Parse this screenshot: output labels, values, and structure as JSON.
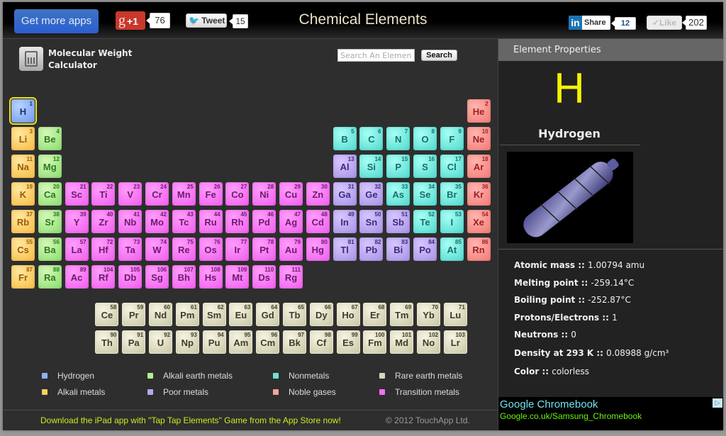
{
  "header": {
    "get_apps_label": "Get more apps",
    "gplus_label": "+1",
    "gplus_count": "76",
    "tweet_label": "Tweet",
    "tweet_count": "15",
    "title": "Chemical Elements",
    "linkedin_label": "Share",
    "linkedin_count": "12",
    "like_label": "✓Like",
    "like_count": "202"
  },
  "toolbar": {
    "calculator_line1": "Molecular Weight",
    "calculator_line2": "Calculator",
    "search_placeholder": "Search An Element",
    "search_button": "Search"
  },
  "selected_element": "H",
  "elements": [
    {
      "s": "H",
      "n": 1,
      "c": "hydrogen",
      "r": 1,
      "col": 1
    },
    {
      "s": "He",
      "n": 2,
      "c": "noble",
      "r": 1,
      "col": 18
    },
    {
      "s": "Li",
      "n": 3,
      "c": "alkali",
      "r": 2,
      "col": 1
    },
    {
      "s": "Be",
      "n": 4,
      "c": "earth",
      "r": 2,
      "col": 2
    },
    {
      "s": "B",
      "n": 5,
      "c": "nonmetal",
      "r": 2,
      "col": 13
    },
    {
      "s": "C",
      "n": 6,
      "c": "nonmetal",
      "r": 2,
      "col": 14
    },
    {
      "s": "N",
      "n": 7,
      "c": "nonmetal",
      "r": 2,
      "col": 15
    },
    {
      "s": "O",
      "n": 8,
      "c": "nonmetal",
      "r": 2,
      "col": 16
    },
    {
      "s": "F",
      "n": 9,
      "c": "nonmetal",
      "r": 2,
      "col": 17
    },
    {
      "s": "Ne",
      "n": 10,
      "c": "noble",
      "r": 2,
      "col": 18
    },
    {
      "s": "Na",
      "n": 11,
      "c": "alkali",
      "r": 3,
      "col": 1
    },
    {
      "s": "Mg",
      "n": 12,
      "c": "earth",
      "r": 3,
      "col": 2
    },
    {
      "s": "Al",
      "n": 13,
      "c": "poor",
      "r": 3,
      "col": 13
    },
    {
      "s": "Si",
      "n": 14,
      "c": "nonmetal",
      "r": 3,
      "col": 14
    },
    {
      "s": "P",
      "n": 15,
      "c": "nonmetal",
      "r": 3,
      "col": 15
    },
    {
      "s": "S",
      "n": 16,
      "c": "nonmetal",
      "r": 3,
      "col": 16
    },
    {
      "s": "Cl",
      "n": 17,
      "c": "nonmetal",
      "r": 3,
      "col": 17
    },
    {
      "s": "Ar",
      "n": 18,
      "c": "noble",
      "r": 3,
      "col": 18
    },
    {
      "s": "K",
      "n": 19,
      "c": "alkali",
      "r": 4,
      "col": 1
    },
    {
      "s": "Ca",
      "n": 20,
      "c": "earth",
      "r": 4,
      "col": 2
    },
    {
      "s": "Sc",
      "n": 21,
      "c": "transition",
      "r": 4,
      "col": 3
    },
    {
      "s": "Ti",
      "n": 22,
      "c": "transition",
      "r": 4,
      "col": 4
    },
    {
      "s": "V",
      "n": 23,
      "c": "transition",
      "r": 4,
      "col": 5
    },
    {
      "s": "Cr",
      "n": 24,
      "c": "transition",
      "r": 4,
      "col": 6
    },
    {
      "s": "Mn",
      "n": 25,
      "c": "transition",
      "r": 4,
      "col": 7
    },
    {
      "s": "Fe",
      "n": 26,
      "c": "transition",
      "r": 4,
      "col": 8
    },
    {
      "s": "Co",
      "n": 27,
      "c": "transition",
      "r": 4,
      "col": 9
    },
    {
      "s": "Ni",
      "n": 28,
      "c": "transition",
      "r": 4,
      "col": 10
    },
    {
      "s": "Cu",
      "n": 29,
      "c": "transition",
      "r": 4,
      "col": 11
    },
    {
      "s": "Zn",
      "n": 30,
      "c": "transition",
      "r": 4,
      "col": 12
    },
    {
      "s": "Ga",
      "n": 31,
      "c": "poor",
      "r": 4,
      "col": 13
    },
    {
      "s": "Ge",
      "n": 32,
      "c": "poor",
      "r": 4,
      "col": 14
    },
    {
      "s": "As",
      "n": 33,
      "c": "nonmetal",
      "r": 4,
      "col": 15
    },
    {
      "s": "Se",
      "n": 34,
      "c": "nonmetal",
      "r": 4,
      "col": 16
    },
    {
      "s": "Br",
      "n": 35,
      "c": "nonmetal",
      "r": 4,
      "col": 17
    },
    {
      "s": "Kr",
      "n": 36,
      "c": "noble",
      "r": 4,
      "col": 18
    },
    {
      "s": "Rb",
      "n": 37,
      "c": "alkali",
      "r": 5,
      "col": 1
    },
    {
      "s": "Sr",
      "n": 38,
      "c": "earth",
      "r": 5,
      "col": 2
    },
    {
      "s": "Y",
      "n": 39,
      "c": "transition",
      "r": 5,
      "col": 3
    },
    {
      "s": "Zr",
      "n": 40,
      "c": "transition",
      "r": 5,
      "col": 4
    },
    {
      "s": "Nb",
      "n": 41,
      "c": "transition",
      "r": 5,
      "col": 5
    },
    {
      "s": "Mo",
      "n": 42,
      "c": "transition",
      "r": 5,
      "col": 6
    },
    {
      "s": "Tc",
      "n": 43,
      "c": "transition",
      "r": 5,
      "col": 7
    },
    {
      "s": "Ru",
      "n": 44,
      "c": "transition",
      "r": 5,
      "col": 8
    },
    {
      "s": "Rh",
      "n": 45,
      "c": "transition",
      "r": 5,
      "col": 9
    },
    {
      "s": "Pd",
      "n": 46,
      "c": "transition",
      "r": 5,
      "col": 10
    },
    {
      "s": "Ag",
      "n": 47,
      "c": "transition",
      "r": 5,
      "col": 11
    },
    {
      "s": "Cd",
      "n": 48,
      "c": "transition",
      "r": 5,
      "col": 12
    },
    {
      "s": "In",
      "n": 49,
      "c": "poor",
      "r": 5,
      "col": 13
    },
    {
      "s": "Sn",
      "n": 50,
      "c": "poor",
      "r": 5,
      "col": 14
    },
    {
      "s": "Sb",
      "n": 51,
      "c": "poor",
      "r": 5,
      "col": 15
    },
    {
      "s": "Te",
      "n": 52,
      "c": "nonmetal",
      "r": 5,
      "col": 16
    },
    {
      "s": "I",
      "n": 53,
      "c": "nonmetal",
      "r": 5,
      "col": 17
    },
    {
      "s": "Xe",
      "n": 54,
      "c": "noble",
      "r": 5,
      "col": 18
    },
    {
      "s": "Cs",
      "n": 55,
      "c": "alkali",
      "r": 6,
      "col": 1
    },
    {
      "s": "Ba",
      "n": 56,
      "c": "earth",
      "r": 6,
      "col": 2
    },
    {
      "s": "La",
      "n": 57,
      "c": "transition",
      "r": 6,
      "col": 3
    },
    {
      "s": "Hf",
      "n": 72,
      "c": "transition",
      "r": 6,
      "col": 4
    },
    {
      "s": "Ta",
      "n": 73,
      "c": "transition",
      "r": 6,
      "col": 5
    },
    {
      "s": "W",
      "n": 74,
      "c": "transition",
      "r": 6,
      "col": 6
    },
    {
      "s": "Re",
      "n": 75,
      "c": "transition",
      "r": 6,
      "col": 7
    },
    {
      "s": "Os",
      "n": 76,
      "c": "transition",
      "r": 6,
      "col": 8
    },
    {
      "s": "Ir",
      "n": 77,
      "c": "transition",
      "r": 6,
      "col": 9
    },
    {
      "s": "Pt",
      "n": 78,
      "c": "transition",
      "r": 6,
      "col": 10
    },
    {
      "s": "Au",
      "n": 79,
      "c": "transition",
      "r": 6,
      "col": 11
    },
    {
      "s": "Hg",
      "n": 80,
      "c": "transition",
      "r": 6,
      "col": 12
    },
    {
      "s": "Tl",
      "n": 81,
      "c": "poor",
      "r": 6,
      "col": 13
    },
    {
      "s": "Pb",
      "n": 82,
      "c": "poor",
      "r": 6,
      "col": 14
    },
    {
      "s": "Bi",
      "n": 83,
      "c": "poor",
      "r": 6,
      "col": 15
    },
    {
      "s": "Po",
      "n": 84,
      "c": "poor",
      "r": 6,
      "col": 16
    },
    {
      "s": "At",
      "n": 85,
      "c": "nonmetal",
      "r": 6,
      "col": 17
    },
    {
      "s": "Rn",
      "n": 86,
      "c": "noble",
      "r": 6,
      "col": 18
    },
    {
      "s": "Fr",
      "n": 87,
      "c": "alkali",
      "r": 7,
      "col": 1
    },
    {
      "s": "Ra",
      "n": 88,
      "c": "earth",
      "r": 7,
      "col": 2
    },
    {
      "s": "Ac",
      "n": 89,
      "c": "transition",
      "r": 7,
      "col": 3
    },
    {
      "s": "Rf",
      "n": 104,
      "c": "transition",
      "r": 7,
      "col": 4
    },
    {
      "s": "Db",
      "n": 105,
      "c": "transition",
      "r": 7,
      "col": 5
    },
    {
      "s": "Sg",
      "n": 106,
      "c": "transition",
      "r": 7,
      "col": 6
    },
    {
      "s": "Bh",
      "n": 107,
      "c": "transition",
      "r": 7,
      "col": 7
    },
    {
      "s": "Hs",
      "n": 108,
      "c": "transition",
      "r": 7,
      "col": 8
    },
    {
      "s": "Mt",
      "n": 109,
      "c": "transition",
      "r": 7,
      "col": 9
    },
    {
      "s": "Ds",
      "n": 110,
      "c": "transition",
      "r": 7,
      "col": 10
    },
    {
      "s": "Rg",
      "n": 111,
      "c": "transition",
      "r": 7,
      "col": 11
    },
    {
      "s": "Ce",
      "n": 58,
      "c": "rare",
      "r": 9,
      "col": 4
    },
    {
      "s": "Pr",
      "n": 59,
      "c": "rare",
      "r": 9,
      "col": 5
    },
    {
      "s": "Nd",
      "n": 60,
      "c": "rare",
      "r": 9,
      "col": 6
    },
    {
      "s": "Pm",
      "n": 61,
      "c": "rare",
      "r": 9,
      "col": 7
    },
    {
      "s": "Sm",
      "n": 62,
      "c": "rare",
      "r": 9,
      "col": 8
    },
    {
      "s": "Eu",
      "n": 63,
      "c": "rare",
      "r": 9,
      "col": 9
    },
    {
      "s": "Gd",
      "n": 64,
      "c": "rare",
      "r": 9,
      "col": 10
    },
    {
      "s": "Tb",
      "n": 65,
      "c": "rare",
      "r": 9,
      "col": 11
    },
    {
      "s": "Dy",
      "n": 66,
      "c": "rare",
      "r": 9,
      "col": 12
    },
    {
      "s": "Ho",
      "n": 67,
      "c": "rare",
      "r": 9,
      "col": 13
    },
    {
      "s": "Er",
      "n": 68,
      "c": "rare",
      "r": 9,
      "col": 14
    },
    {
      "s": "Tm",
      "n": 69,
      "c": "rare",
      "r": 9,
      "col": 15
    },
    {
      "s": "Yb",
      "n": 70,
      "c": "rare",
      "r": 9,
      "col": 16
    },
    {
      "s": "Lu",
      "n": 71,
      "c": "rare",
      "r": 9,
      "col": 17
    },
    {
      "s": "Th",
      "n": 90,
      "c": "rare",
      "r": 10,
      "col": 4
    },
    {
      "s": "Pa",
      "n": 91,
      "c": "rare",
      "r": 10,
      "col": 5
    },
    {
      "s": "U",
      "n": 92,
      "c": "rare",
      "r": 10,
      "col": 6
    },
    {
      "s": "Np",
      "n": 93,
      "c": "rare",
      "r": 10,
      "col": 7
    },
    {
      "s": "Pu",
      "n": 94,
      "c": "rare",
      "r": 10,
      "col": 8
    },
    {
      "s": "Am",
      "n": 95,
      "c": "rare",
      "r": 10,
      "col": 9
    },
    {
      "s": "Cm",
      "n": 96,
      "c": "rare",
      "r": 10,
      "col": 10
    },
    {
      "s": "Bk",
      "n": 97,
      "c": "rare",
      "r": 10,
      "col": 11
    },
    {
      "s": "Cf",
      "n": 98,
      "c": "rare",
      "r": 10,
      "col": 12
    },
    {
      "s": "Es",
      "n": 99,
      "c": "rare",
      "r": 10,
      "col": 13
    },
    {
      "s": "Fm",
      "n": 100,
      "c": "rare",
      "r": 10,
      "col": 14
    },
    {
      "s": "Md",
      "n": 101,
      "c": "rare",
      "r": 10,
      "col": 15
    },
    {
      "s": "No",
      "n": 102,
      "c": "rare",
      "r": 10,
      "col": 16
    },
    {
      "s": "Lr",
      "n": 103,
      "c": "rare",
      "r": 10,
      "col": 17
    }
  ],
  "legend": [
    {
      "label": "Hydrogen",
      "color": "#8fb0f4"
    },
    {
      "label": "Alkali metals",
      "color": "#f6d15c"
    },
    {
      "label": "Alkali earth metals",
      "color": "#b2f08c"
    },
    {
      "label": "Poor metals",
      "color": "#b9a6f2"
    },
    {
      "label": "Nonmetals",
      "color": "#6fe0d8"
    },
    {
      "label": "Noble gases",
      "color": "#f7a09c"
    },
    {
      "label": "Rare earth metals",
      "color": "#d8d6bd"
    },
    {
      "label": "Transition metals",
      "color": "#f56ef3"
    }
  ],
  "footer": {
    "promo": "Download the iPad app with \"Tap Tap Elements\" Game from the App Store now!",
    "copyright": "© 2012 TouchApp Ltd."
  },
  "panel": {
    "header": "Element Properties",
    "symbol": "H",
    "name": "Hydrogen",
    "image_alt": "Glowing hydrogen gas discharge tube",
    "properties": [
      {
        "label": "Atomic mass :: ",
        "value": "1.00794 amu"
      },
      {
        "label": "Melting point :: ",
        "value": "-259.14°C"
      },
      {
        "label": "Boiling point :: ",
        "value": "-252.87°C"
      },
      {
        "label": "Protons/Electrons :: ",
        "value": "1"
      },
      {
        "label": "Neutrons :: ",
        "value": "0"
      },
      {
        "label": "Density at 293 K :: ",
        "value": "0.08988 g/cm³"
      },
      {
        "label": "Color :: ",
        "value": "colorless"
      }
    ]
  },
  "ad": {
    "title": "Google Chromebook",
    "url": "Google.co.uk/Samsung_Chromebook",
    "choices_icon": "▷"
  }
}
